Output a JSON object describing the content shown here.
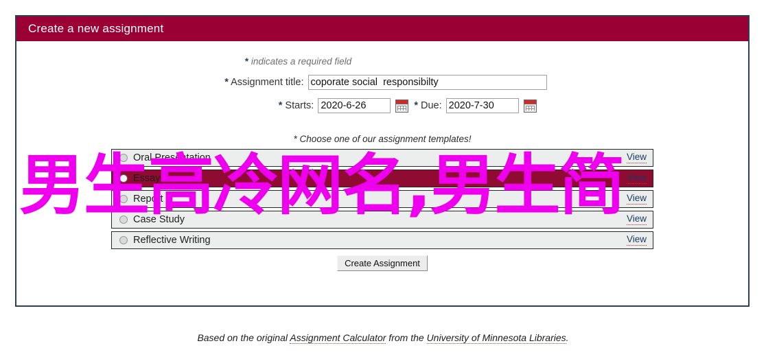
{
  "window": {
    "title": "Create a new assignment"
  },
  "form": {
    "required_note_star": "*",
    "required_note": " indicates a required field",
    "title_label": "Assignment title:",
    "title_value": "coporate social  responsibilty",
    "starts_label": "Starts:",
    "starts_value": "2020-6-26",
    "due_label": "Due:",
    "due_value": "2020-7-30",
    "required_marker": "*",
    "start_calendar_icon": "calendar-icon",
    "due_calendar_icon": "calendar-icon"
  },
  "templates": {
    "prompt": "* Choose one of our assignment templates!",
    "view_label": "View",
    "items": [
      {
        "label": "Oral Presentation",
        "selected": false
      },
      {
        "label": "Essay",
        "selected": true
      },
      {
        "label": "Report",
        "selected": false
      },
      {
        "label": "Case Study",
        "selected": false
      },
      {
        "label": "Reflective Writing",
        "selected": false
      }
    ]
  },
  "actions": {
    "create_label": "Create Assignment"
  },
  "footer": {
    "prefix": "Based on the original ",
    "link1": "Assignment Calculator",
    "middle": " from the ",
    "link2": "University of Minnesota Libraries",
    "suffix": "."
  },
  "overlay": {
    "text": "男生高冷网名,男生简"
  },
  "colors": {
    "header_crimson": "#9b0034",
    "selected_row": "#8f0b31",
    "panel_border": "#2e4053",
    "overlay_magenta": "#ee00ee"
  }
}
